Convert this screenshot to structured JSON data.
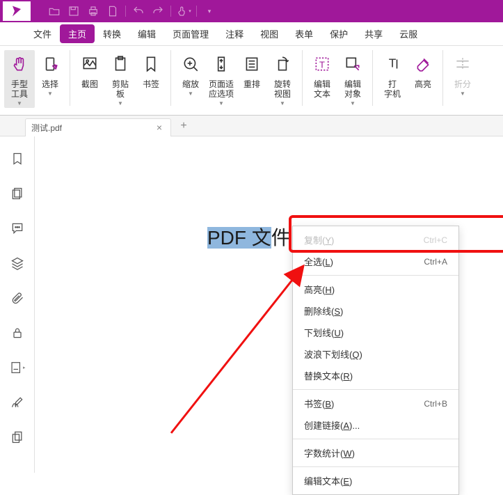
{
  "menubar": [
    "文件",
    "主页",
    "转换",
    "编辑",
    "页面管理",
    "注释",
    "视图",
    "表单",
    "保护",
    "共享",
    "云服"
  ],
  "menubar_active_index": 1,
  "ribbon": [
    {
      "label": "手型\n工具",
      "selected": true,
      "drop": true
    },
    {
      "label": "选择",
      "drop": true
    },
    {
      "sep": true
    },
    {
      "label": "截图"
    },
    {
      "label": "剪贴\n板",
      "drop": true
    },
    {
      "label": "书签"
    },
    {
      "sep": true
    },
    {
      "label": "缩放",
      "drop": true
    },
    {
      "label": "页面适\n应选项",
      "drop": true
    },
    {
      "label": "重排"
    },
    {
      "label": "旋转\n视图",
      "drop": true
    },
    {
      "sep": true
    },
    {
      "label": "编辑\n文本"
    },
    {
      "label": "编辑\n对象",
      "drop": true
    },
    {
      "sep": true
    },
    {
      "label": "打\n字机"
    },
    {
      "label": "高亮"
    },
    {
      "sep": true
    },
    {
      "label": "折分",
      "drop": true,
      "dim": true
    }
  ],
  "tab": {
    "title": "测试.pdf",
    "close": "×",
    "add": "+"
  },
  "selected_text": {
    "pre": "PDF 文",
    "post": "件"
  },
  "context_menu": [
    {
      "label": "复制(<u>Y</u>)",
      "shortcut": "Ctrl+C",
      "disabled": true
    },
    {
      "label": "全选(<u>L</u>)",
      "shortcut": "Ctrl+A"
    },
    {
      "hr": true
    },
    {
      "label": "高亮(<u>H</u>)"
    },
    {
      "label": "删除线(<u>S</u>)"
    },
    {
      "label": "下划线(<u>U</u>)"
    },
    {
      "label": "波浪下划线(<u>Q</u>)"
    },
    {
      "label": "替换文本(<u>R</u>)"
    },
    {
      "hr": true
    },
    {
      "label": "书签(<u>B</u>)",
      "shortcut": "Ctrl+B"
    },
    {
      "label": "创建链接(<u>A</u>)..."
    },
    {
      "hr": true
    },
    {
      "label": "字数统计(<u>W</u>)"
    },
    {
      "hr": true
    },
    {
      "label": "编辑文本(<u>E</u>)"
    }
  ]
}
